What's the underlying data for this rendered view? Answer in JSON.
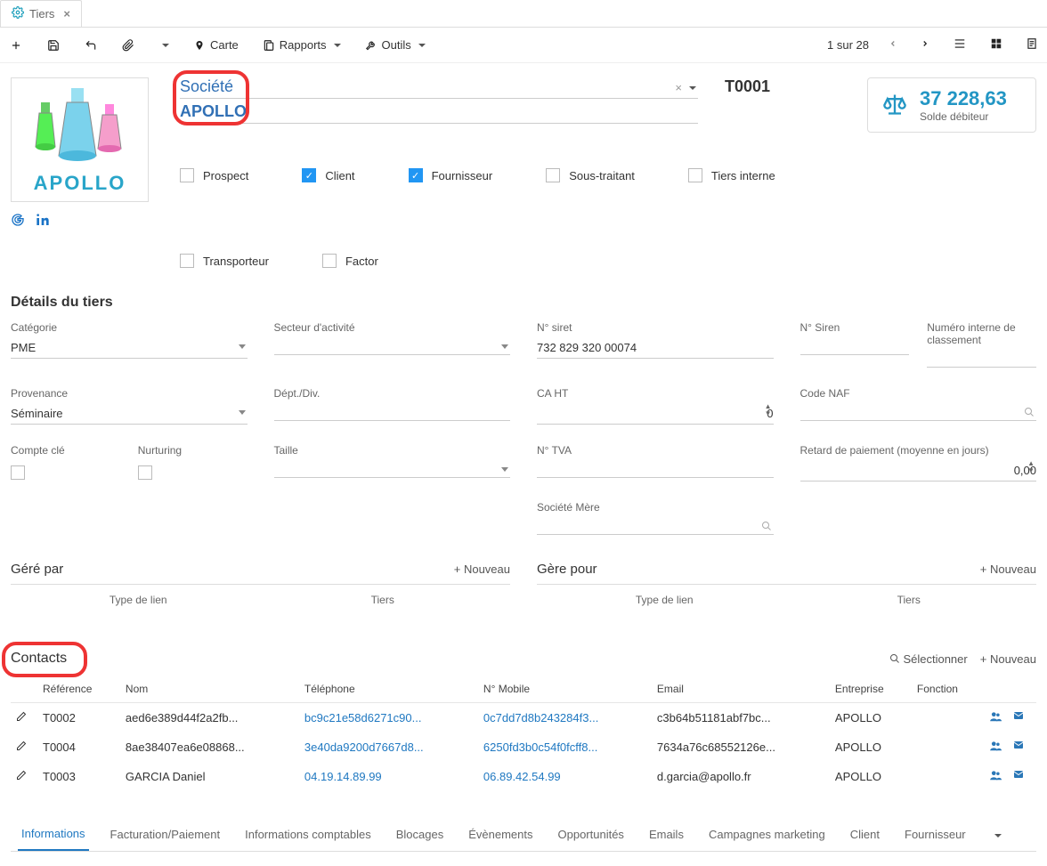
{
  "tab": {
    "title": "Tiers"
  },
  "toolbar": {
    "carte": "Carte",
    "rapports": "Rapports",
    "outils": "Outils",
    "pager": "1 sur 28"
  },
  "header": {
    "type_label": "Société",
    "name": "APOLLO",
    "code": "T0001",
    "balance_amount": "37 228,63",
    "balance_label": "Solde débiteur",
    "logo_text": "APOLLO"
  },
  "checks": {
    "prospect": "Prospect",
    "client": "Client",
    "fournisseur": "Fournisseur",
    "sous_traitant": "Sous-traitant",
    "tiers_interne": "Tiers interne",
    "transporteur": "Transporteur",
    "factor": "Factor"
  },
  "details": {
    "title": "Détails du tiers",
    "categorie_label": "Catégorie",
    "categorie": "PME",
    "secteur_label": "Secteur d'activité",
    "secteur": "",
    "siret_label": "N° siret",
    "siret": "732 829 320 00074",
    "siren_label": "N° Siren",
    "siren": "",
    "num_interne_label": "Numéro interne de classement",
    "num_interne": "",
    "provenance_label": "Provenance",
    "provenance": "Séminaire",
    "dept_label": "Dépt./Div.",
    "dept": "",
    "caht_label": "CA HT",
    "caht": "0",
    "naf_label": "Code NAF",
    "naf": "",
    "compte_cle_label": "Compte clé",
    "nurturing_label": "Nurturing",
    "taille_label": "Taille",
    "taille": "",
    "tva_label": "N° TVA",
    "tva": "",
    "retard_label": "Retard de paiement (moyenne en jours)",
    "retard": "0,00",
    "societe_mere_label": "Société Mère",
    "societe_mere": ""
  },
  "relations": {
    "gere_par": "Géré par",
    "gere_pour": "Gère pour",
    "nouveau": "Nouveau",
    "col_type": "Type de lien",
    "col_tiers": "Tiers"
  },
  "contacts": {
    "title": "Contacts",
    "selectionner": "Sélectionner",
    "nouveau": "Nouveau",
    "cols": {
      "ref": "Référence",
      "nom": "Nom",
      "tel": "Téléphone",
      "mob": "N° Mobile",
      "email": "Email",
      "ent": "Entreprise",
      "fn": "Fonction"
    },
    "rows": [
      {
        "ref": "T0002",
        "nom": "aed6e389d44f2a2fb...",
        "tel": "bc9c21e58d6271c90...",
        "mob": "0c7dd7d8b243284f3...",
        "email": "c3b64b51181abf7bc...",
        "ent": "APOLLO"
      },
      {
        "ref": "T0004",
        "nom": "8ae38407ea6e08868...",
        "tel": "3e40da9200d7667d8...",
        "mob": "6250fd3b0c54f0fcff8...",
        "email": "7634a76c68552126e...",
        "ent": "APOLLO"
      },
      {
        "ref": "T0003",
        "nom": "GARCIA Daniel",
        "tel": "04.19.14.89.99",
        "mob": "06.89.42.54.99",
        "email": "d.garcia@apollo.fr",
        "ent": "APOLLO"
      }
    ]
  },
  "bottom_tabs": [
    "Informations",
    "Facturation/Paiement",
    "Informations comptables",
    "Blocages",
    "Évènements",
    "Opportunités",
    "Emails",
    "Campagnes marketing",
    "Client",
    "Fournisseur"
  ]
}
